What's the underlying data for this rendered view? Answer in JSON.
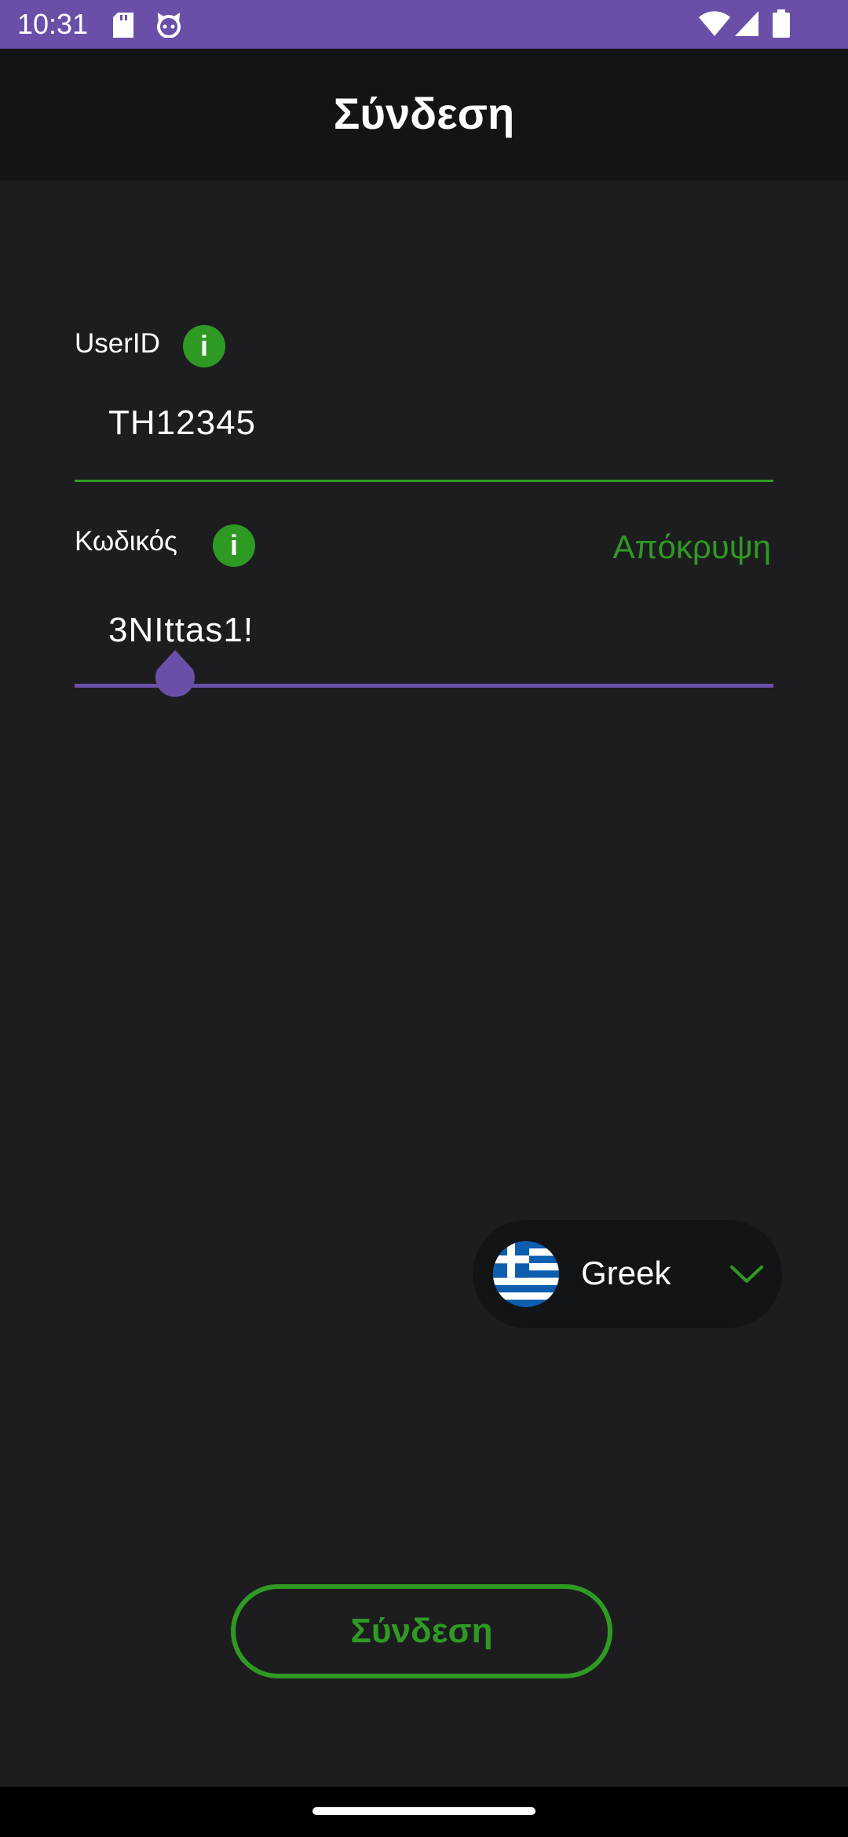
{
  "status_bar": {
    "time": "10:31",
    "icons": [
      "sd-card-icon",
      "cat-face-icon",
      "wifi-icon",
      "signal-icon",
      "battery-icon"
    ],
    "color": "#6a4fa8"
  },
  "app_bar": {
    "title": "Σύνδεση"
  },
  "user_field": {
    "label": "UserID",
    "info": "i",
    "value": "TH12345"
  },
  "password_field": {
    "label": "Κωδικός",
    "info": "i",
    "value": "3NIttas1!",
    "toggle_label": "Απόκρυψη"
  },
  "language": {
    "selected": "Greek",
    "flag": "greece-flag-icon",
    "dropdown_icon": "chevron-down-icon"
  },
  "login_button": {
    "label": "Σύνδεση"
  },
  "colors": {
    "accent_green": "#2f9a23",
    "accent_purple": "#6a4fa8",
    "background": "#1d1d1f",
    "app_bar": "#131416"
  }
}
